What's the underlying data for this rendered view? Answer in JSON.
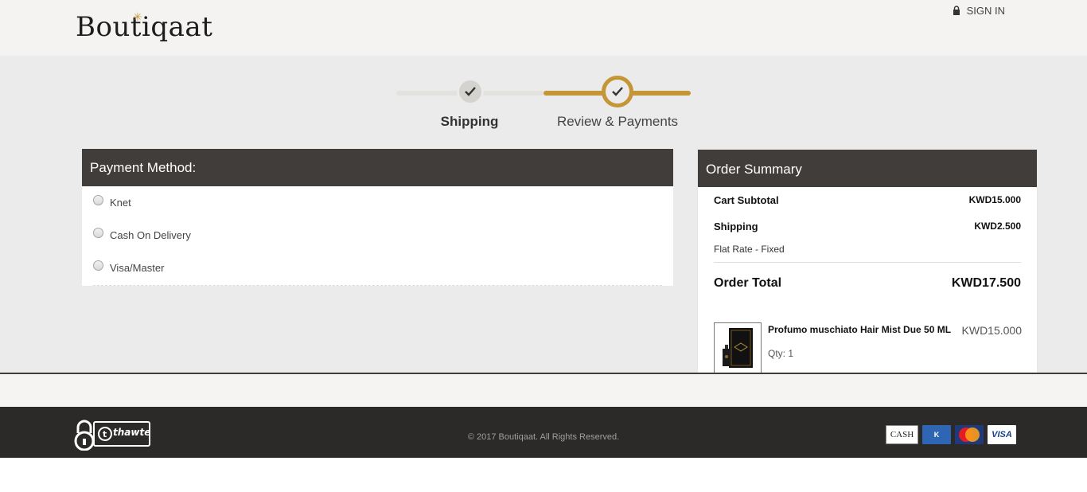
{
  "header": {
    "logo_text": "Boutiqaat",
    "signin_label": "SIGN IN"
  },
  "steps": [
    {
      "label": "Shipping",
      "state": "completed"
    },
    {
      "label": "Review & Payments",
      "state": "active"
    }
  ],
  "payment": {
    "title": "Payment Method:",
    "options": [
      {
        "label": "Knet",
        "selected": false
      },
      {
        "label": "Cash On Delivery",
        "selected": false
      },
      {
        "label": "Visa/Master",
        "selected": false
      }
    ]
  },
  "summary": {
    "title": "Order Summary",
    "subtotal_label": "Cart Subtotal",
    "subtotal_value": "KWD15.000",
    "shipping_label": "Shipping",
    "shipping_value": "KWD2.500",
    "shipping_method": "Flat Rate - Fixed",
    "total_label": "Order Total",
    "total_value": "KWD17.500",
    "item": {
      "name": "Profumo muschiato Hair Mist Due 50 ML",
      "price": "KWD15.000",
      "qty": "Qty: 1"
    }
  },
  "footer": {
    "copyright": "© 2017 Boutiqaat. All Rights Reserved.",
    "thawte_text": "thawte",
    "payment_icons": [
      "CASH",
      "K net",
      "MasterCard",
      "VISA"
    ]
  },
  "colors": {
    "accent": "#c59636",
    "dark": "#403d3b",
    "footer_bg": "#2b2a29"
  }
}
